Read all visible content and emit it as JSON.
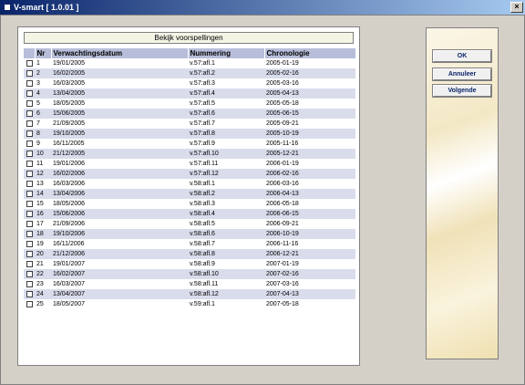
{
  "window": {
    "title": "V-smart [ 1.0.01 ]"
  },
  "panel": {
    "caption": "Bekijk voorspellingen"
  },
  "table": {
    "headers": {
      "nr": "Nr",
      "date": "Verwachtingsdatum",
      "number": "Nummering",
      "chron": "Chronologie"
    },
    "rows": [
      [
        "1",
        "19/01/2005",
        "v.57:afl.1",
        "2005-01-19"
      ],
      [
        "2",
        "16/02/2005",
        "v.57:afl.2",
        "2005-02-16"
      ],
      [
        "3",
        "16/03/2005",
        "v.57:afl.3",
        "2005-03-16"
      ],
      [
        "4",
        "13/04/2005",
        "v.57:afl.4",
        "2005-04-13"
      ],
      [
        "5",
        "18/05/2005",
        "v.57:afl.5",
        "2005-05-18"
      ],
      [
        "6",
        "15/06/2005",
        "v.57:afl.6",
        "2005-06-15"
      ],
      [
        "7",
        "21/09/2005",
        "v.57:afl.7",
        "2005-09-21"
      ],
      [
        "8",
        "19/10/2005",
        "v.57:afl.8",
        "2005-10-19"
      ],
      [
        "9",
        "16/11/2005",
        "v.57:afl.9",
        "2005-11-16"
      ],
      [
        "10",
        "21/12/2005",
        "v.57:afl.10",
        "2005-12-21"
      ],
      [
        "11",
        "19/01/2006",
        "v.57:afl.11",
        "2006-01-19"
      ],
      [
        "12",
        "16/02/2006",
        "v.57:afl.12",
        "2006-02-16"
      ],
      [
        "13",
        "16/03/2006",
        "v.58:afl.1",
        "2006-03-16"
      ],
      [
        "14",
        "13/04/2006",
        "v.58:afl.2",
        "2006-04-13"
      ],
      [
        "15",
        "18/05/2006",
        "v.58:afl.3",
        "2006-05-18"
      ],
      [
        "16",
        "15/06/2006",
        "v.58:afl.4",
        "2006-06-15"
      ],
      [
        "17",
        "21/09/2006",
        "v.58:afl.5",
        "2006-09-21"
      ],
      [
        "18",
        "19/10/2006",
        "v.58:afl.6",
        "2006-10-19"
      ],
      [
        "19",
        "16/11/2006",
        "v.58:afl.7",
        "2006-11-16"
      ],
      [
        "20",
        "21/12/2006",
        "v.58:afl.8",
        "2006-12-21"
      ],
      [
        "21",
        "19/01/2007",
        "v.58:afl.9",
        "2007-01-19"
      ],
      [
        "22",
        "16/02/2007",
        "v.58:afl.10",
        "2007-02-16"
      ],
      [
        "23",
        "16/03/2007",
        "v.58:afl.11",
        "2007-03-16"
      ],
      [
        "24",
        "13/04/2007",
        "v.58:afl.12",
        "2007-04-13"
      ],
      [
        "25",
        "18/05/2007",
        "v.59:afl.1",
        "2007-05-18"
      ]
    ]
  },
  "buttons": {
    "ok": "OK",
    "cancel": "Annuleer",
    "next": "Volgende"
  },
  "colors": {
    "title_start": "#0A246A",
    "title_end": "#A6CAF0",
    "header_bg": "#B8BEDA",
    "row_alt": "#D9DCEB"
  }
}
